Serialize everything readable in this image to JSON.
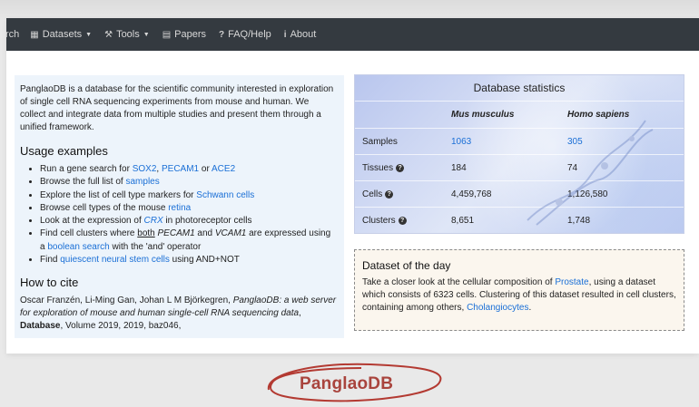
{
  "nav": {
    "items": [
      {
        "icon": "search-icon",
        "label": "rch"
      },
      {
        "icon": "database-icon",
        "label": "Datasets",
        "dropdown": true
      },
      {
        "icon": "wrench-icon",
        "label": "Tools",
        "dropdown": true
      },
      {
        "icon": "book-icon",
        "label": "Papers"
      },
      {
        "icon": "question-icon",
        "label": "FAQ/Help"
      },
      {
        "icon": "info-icon",
        "label": "About"
      }
    ]
  },
  "intro": "PanglaoDB is a database for the scientific community interested in exploration of single cell RNA sequencing experiments from mouse and human. We collect and integrate data from multiple studies and present them through a unified framework.",
  "usage": {
    "title": "Usage examples",
    "l1": {
      "pre": "Run a gene search for ",
      "a": "SOX2",
      "sep1": ", ",
      "b": "PECAM1",
      "sep2": " or ",
      "c": "ACE2"
    },
    "l2": {
      "pre": "Browse the full list of ",
      "a": "samples"
    },
    "l3": {
      "pre": "Explore the list of cell type markers for ",
      "a": "Schwann cells"
    },
    "l4": {
      "pre": "Browse cell types of the mouse ",
      "a": "retina"
    },
    "l5": {
      "pre": "Look at the expression of ",
      "a": "CRX",
      "post": " in photoreceptor cells"
    },
    "l6": {
      "pre": "Find cell clusters where ",
      "both": "both",
      "g1": "PECAM1",
      "and": " and ",
      "g2": "VCAM1",
      "post": " are expressed using a ",
      "a": "boolean search",
      "post2": " with the 'and' operator"
    },
    "l7": {
      "pre": "Find ",
      "a": "quiescent neural stem cells",
      "post": " using AND+NOT"
    }
  },
  "cite": {
    "title": "How to cite",
    "authors": "Oscar Franzén, Li-Ming Gan, Johan L M Björkegren, ",
    "paper": "PanglaoDB: a web server for exploration of mouse and human single-cell RNA sequencing data",
    "sep": ", ",
    "journal": "Database",
    "rest": ", Volume 2019, 2019, baz046,"
  },
  "stats": {
    "title": "Database statistics",
    "col_mouse": "Mus musculus",
    "col_human": "Homo sapiens",
    "rows": [
      {
        "label": "Samples",
        "mouse": "1063",
        "human": "305"
      },
      {
        "label": "Tissues",
        "mouse": "184",
        "human": "74"
      },
      {
        "label": "Cells",
        "mouse": "4,459,768",
        "human": "1,126,580"
      },
      {
        "label": "Clusters",
        "mouse": "8,651",
        "human": "1,748"
      }
    ]
  },
  "dotd": {
    "title": "Dataset of the day",
    "pre": "Take a closer look at the cellular composition of ",
    "tissue": "Prostate",
    "mid": ", using a dataset which consists of 6323 cells. Clustering of this dataset resulted in cell clusters, containing among others, ",
    "celltype": "Cholangiocytes",
    "post": "."
  },
  "logo": "PanglaoDB",
  "colors": {
    "navbar": "#343a40",
    "link": "#1a6fd6",
    "logo": "#a9443d",
    "panel": "#edf4fb"
  }
}
